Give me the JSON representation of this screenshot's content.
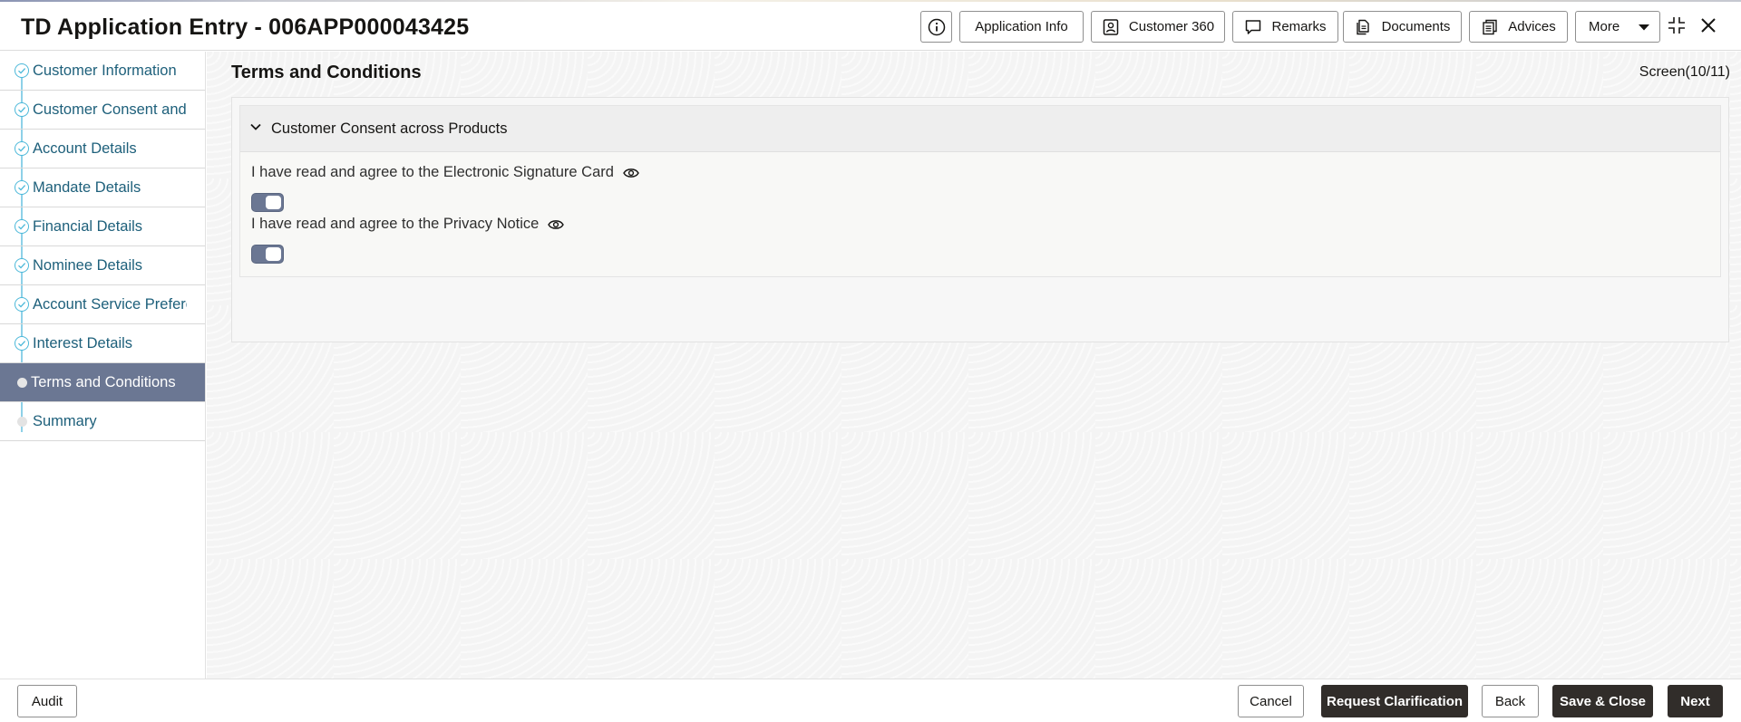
{
  "header": {
    "title": "TD Application Entry - 006APP000043425",
    "buttons": {
      "application_info": "Application Info",
      "customer_360": "Customer 360",
      "remarks": "Remarks",
      "documents": "Documents",
      "advices": "Advices",
      "more": "More"
    },
    "icons": [
      "info-icon",
      "user-card-icon",
      "comment-icon",
      "documents-icon",
      "advices-icon",
      "caret-down-icon",
      "minimize-icon",
      "close-icon"
    ]
  },
  "sidebar": {
    "items": [
      {
        "label": "Customer Information",
        "state": "completed"
      },
      {
        "label": "Customer Consent and ...",
        "state": "completed"
      },
      {
        "label": "Account Details",
        "state": "completed"
      },
      {
        "label": "Mandate Details",
        "state": "completed"
      },
      {
        "label": "Financial Details",
        "state": "completed"
      },
      {
        "label": "Nominee Details",
        "state": "completed"
      },
      {
        "label": "Account Service Prefere...",
        "state": "completed"
      },
      {
        "label": "Interest Details",
        "state": "completed"
      },
      {
        "label": "Terms and Conditions",
        "state": "active"
      },
      {
        "label": "Summary",
        "state": "pending"
      }
    ]
  },
  "main": {
    "title": "Terms and Conditions",
    "screen_counter": "Screen(10/11)",
    "section": {
      "title": "Customer Consent across Products",
      "consents": [
        {
          "label": "I have read and agree to the Electronic Signature Card",
          "checked": true
        },
        {
          "label": "I have read and agree to the Privacy Notice",
          "checked": true
        }
      ]
    }
  },
  "footer": {
    "audit": "Audit",
    "cancel": "Cancel",
    "request_clarification": "Request Clarification",
    "back": "Back",
    "save_close": "Save & Close",
    "next": "Next"
  },
  "colors": {
    "accent": "#6b7793",
    "nav_text": "#1e607b",
    "step_ring": "#4bb8d9",
    "primary_button": "#312d2a"
  }
}
